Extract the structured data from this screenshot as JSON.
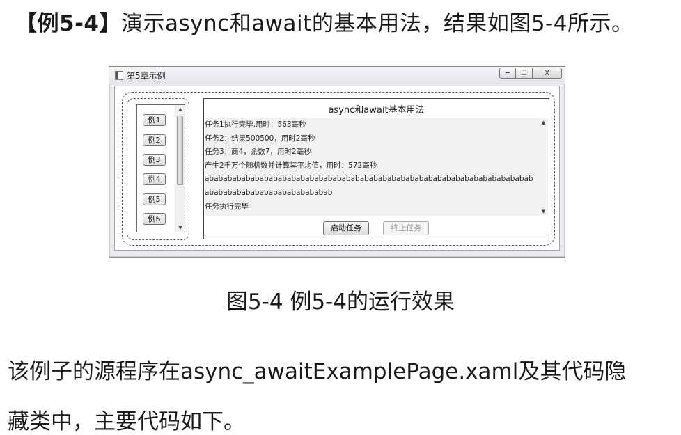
{
  "heading": {
    "tag": "【例5-4】",
    "text": "演示async和await的基本用法，结果如图5-4所示。"
  },
  "window": {
    "title": "第5章示例",
    "controls": {
      "minimize": "─",
      "maximize": "☐",
      "close": "X"
    },
    "examples": [
      "例1",
      "例2",
      "例3",
      "例4",
      "例5",
      "例6"
    ],
    "panel_title": "async和await基本用法",
    "output_lines": [
      "任务1执行完毕,用时：563毫秒",
      "任务2：结果500500，用时2毫秒",
      "任务3：商4，余数7，用时2毫秒",
      "产生2千万个随机数并计算其平均值，用时：572毫秒",
      "abababababababababababababababababababababababababababababababababababab",
      "abababababababababababababab",
      "任务执行完毕"
    ],
    "start_button": "启动任务",
    "stop_button": "终止任务"
  },
  "caption": "图5-4  例5-4的运行效果",
  "paragraph": {
    "line1": "该例子的源程序在async_awaitExamplePage.xaml及其代码隐",
    "line2": "藏类中，主要代码如下。"
  }
}
